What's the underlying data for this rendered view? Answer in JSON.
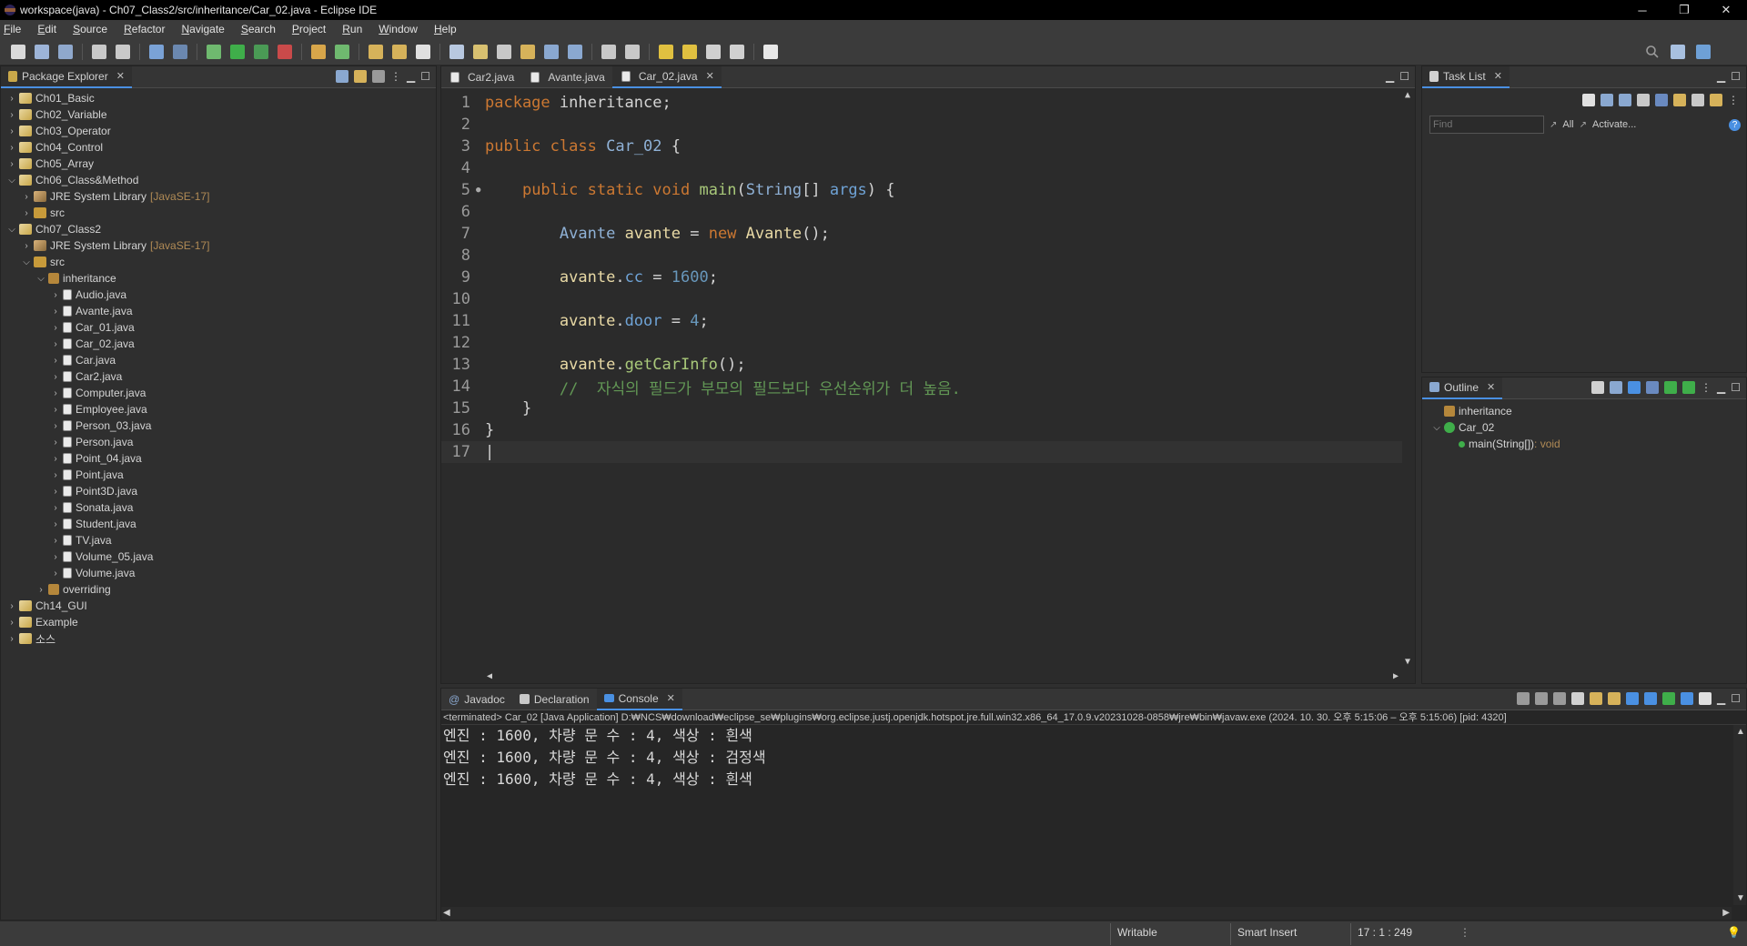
{
  "window": {
    "title": "workspace(java) - Ch07_Class2/src/inheritance/Car_02.java - Eclipse IDE",
    "minimize": "─",
    "restore": "❐",
    "close": "✕"
  },
  "menu": [
    "File",
    "Edit",
    "Source",
    "Refactor",
    "Navigate",
    "Search",
    "Project",
    "Run",
    "Window",
    "Help"
  ],
  "package_explorer": {
    "title": "Package Explorer",
    "tree": [
      {
        "depth": 0,
        "expanded": false,
        "icon": "project",
        "label": "Ch01_Basic"
      },
      {
        "depth": 0,
        "expanded": false,
        "icon": "project",
        "label": "Ch02_Variable"
      },
      {
        "depth": 0,
        "expanded": false,
        "icon": "project",
        "label": "Ch03_Operator"
      },
      {
        "depth": 0,
        "expanded": false,
        "icon": "project",
        "label": "Ch04_Control"
      },
      {
        "depth": 0,
        "expanded": false,
        "icon": "project",
        "label": "Ch05_Array"
      },
      {
        "depth": 0,
        "expanded": true,
        "icon": "project",
        "label": "Ch06_Class&Method"
      },
      {
        "depth": 1,
        "expanded": false,
        "icon": "lib",
        "label": "JRE System Library",
        "tag": "[JavaSE-17]"
      },
      {
        "depth": 1,
        "expanded": false,
        "icon": "src",
        "label": "src"
      },
      {
        "depth": 0,
        "expanded": true,
        "icon": "project",
        "label": "Ch07_Class2"
      },
      {
        "depth": 1,
        "expanded": false,
        "icon": "lib",
        "label": "JRE System Library",
        "tag": "[JavaSE-17]"
      },
      {
        "depth": 1,
        "expanded": true,
        "icon": "src",
        "label": "src"
      },
      {
        "depth": 2,
        "expanded": true,
        "icon": "pkg",
        "label": "inheritance"
      },
      {
        "depth": 3,
        "expanded": false,
        "icon": "java",
        "label": "Audio.java"
      },
      {
        "depth": 3,
        "expanded": false,
        "icon": "java",
        "label": "Avante.java"
      },
      {
        "depth": 3,
        "expanded": false,
        "icon": "java",
        "label": "Car_01.java"
      },
      {
        "depth": 3,
        "expanded": false,
        "icon": "java",
        "label": "Car_02.java"
      },
      {
        "depth": 3,
        "expanded": false,
        "icon": "java",
        "label": "Car.java"
      },
      {
        "depth": 3,
        "expanded": false,
        "icon": "java",
        "label": "Car2.java"
      },
      {
        "depth": 3,
        "expanded": false,
        "icon": "java",
        "label": "Computer.java"
      },
      {
        "depth": 3,
        "expanded": false,
        "icon": "java",
        "label": "Employee.java"
      },
      {
        "depth": 3,
        "expanded": false,
        "icon": "java",
        "label": "Person_03.java"
      },
      {
        "depth": 3,
        "expanded": false,
        "icon": "java",
        "label": "Person.java"
      },
      {
        "depth": 3,
        "expanded": false,
        "icon": "java",
        "label": "Point_04.java"
      },
      {
        "depth": 3,
        "expanded": false,
        "icon": "java",
        "label": "Point.java"
      },
      {
        "depth": 3,
        "expanded": false,
        "icon": "java",
        "label": "Point3D.java"
      },
      {
        "depth": 3,
        "expanded": false,
        "icon": "java",
        "label": "Sonata.java"
      },
      {
        "depth": 3,
        "expanded": false,
        "icon": "java",
        "label": "Student.java"
      },
      {
        "depth": 3,
        "expanded": false,
        "icon": "java",
        "label": "TV.java"
      },
      {
        "depth": 3,
        "expanded": false,
        "icon": "java",
        "label": "Volume_05.java"
      },
      {
        "depth": 3,
        "expanded": false,
        "icon": "java",
        "label": "Volume.java"
      },
      {
        "depth": 2,
        "expanded": false,
        "icon": "pkg",
        "label": "overriding"
      },
      {
        "depth": 0,
        "expanded": false,
        "icon": "project",
        "label": "Ch14_GUI"
      },
      {
        "depth": 0,
        "expanded": false,
        "icon": "project",
        "label": "Example"
      },
      {
        "depth": 0,
        "expanded": false,
        "icon": "project",
        "label": "소스"
      }
    ]
  },
  "editor": {
    "tabs": [
      {
        "label": "Car2.java",
        "active": false
      },
      {
        "label": "Avante.java",
        "active": false
      },
      {
        "label": "Car_02.java",
        "active": true
      }
    ],
    "lines": [
      {
        "n": "1",
        "tokens": [
          [
            "kw",
            "package"
          ],
          [
            "txt",
            " inheritance;"
          ]
        ]
      },
      {
        "n": "2",
        "tokens": []
      },
      {
        "n": "3",
        "tokens": [
          [
            "kw",
            "public"
          ],
          [
            "txt",
            " "
          ],
          [
            "kw",
            "class"
          ],
          [
            "txt",
            " "
          ],
          [
            "cls",
            "Car_02"
          ],
          [
            "txt",
            " {"
          ]
        ]
      },
      {
        "n": "4",
        "tokens": []
      },
      {
        "n": "5",
        "marker": "●",
        "tokens": [
          [
            "txt",
            "    "
          ],
          [
            "kw",
            "public"
          ],
          [
            "txt",
            " "
          ],
          [
            "kw",
            "static"
          ],
          [
            "txt",
            " "
          ],
          [
            "kw",
            "void"
          ],
          [
            "txt",
            " "
          ],
          [
            "mth",
            "main"
          ],
          [
            "txt",
            "("
          ],
          [
            "cls",
            "String"
          ],
          [
            "txt",
            "[] "
          ],
          [
            "fld",
            "args"
          ],
          [
            "txt",
            ") {"
          ]
        ]
      },
      {
        "n": "6",
        "tokens": []
      },
      {
        "n": "7",
        "tokens": [
          [
            "txt",
            "        "
          ],
          [
            "cls",
            "Avante"
          ],
          [
            "txt",
            " "
          ],
          [
            "var",
            "avante"
          ],
          [
            "txt",
            " = "
          ],
          [
            "kw",
            "new"
          ],
          [
            "txt",
            " "
          ],
          [
            "var",
            "Avante"
          ],
          [
            "txt",
            "();"
          ]
        ]
      },
      {
        "n": "8",
        "tokens": []
      },
      {
        "n": "9",
        "tokens": [
          [
            "txt",
            "        "
          ],
          [
            "var",
            "avante"
          ],
          [
            "txt",
            "."
          ],
          [
            "fld",
            "cc"
          ],
          [
            "txt",
            " = "
          ],
          [
            "num",
            "1600"
          ],
          [
            "txt",
            ";"
          ]
        ]
      },
      {
        "n": "10",
        "tokens": []
      },
      {
        "n": "11",
        "tokens": [
          [
            "txt",
            "        "
          ],
          [
            "var",
            "avante"
          ],
          [
            "txt",
            "."
          ],
          [
            "fld",
            "door"
          ],
          [
            "txt",
            " = "
          ],
          [
            "num",
            "4"
          ],
          [
            "txt",
            ";"
          ]
        ]
      },
      {
        "n": "12",
        "tokens": []
      },
      {
        "n": "13",
        "tokens": [
          [
            "txt",
            "        "
          ],
          [
            "var",
            "avante"
          ],
          [
            "txt",
            "."
          ],
          [
            "mth",
            "getCarInfo"
          ],
          [
            "txt",
            "();"
          ]
        ]
      },
      {
        "n": "14",
        "tokens": [
          [
            "txt",
            "        "
          ],
          [
            "cmt",
            "//  자식의 필드가 부모의 필드보다 우선순위가 더 높음."
          ]
        ]
      },
      {
        "n": "15",
        "tokens": [
          [
            "txt",
            "    }"
          ]
        ]
      },
      {
        "n": "16",
        "tokens": [
          [
            "txt",
            "}"
          ]
        ]
      },
      {
        "n": "17",
        "current": true,
        "tokens": [
          [
            "txt",
            "|"
          ]
        ]
      }
    ]
  },
  "task_list": {
    "title": "Task List",
    "find_placeholder": "Find",
    "all_label": "All",
    "activate_label": "Activate..."
  },
  "outline": {
    "title": "Outline",
    "items": [
      {
        "depth": 0,
        "label": "inheritance",
        "suffix": ""
      },
      {
        "depth": 0,
        "expanded": true,
        "label": "Car_02",
        "suffix": ""
      },
      {
        "depth": 1,
        "label": "main(String[])",
        "suffix": " : void"
      }
    ]
  },
  "bottom": {
    "tabs": [
      {
        "label": "Javadoc",
        "active": false
      },
      {
        "label": "Declaration",
        "active": false
      },
      {
        "label": "Console",
        "active": true
      }
    ],
    "terminated": "<terminated> Car_02 [Java Application] D:₩NCS₩download₩eclipse_se₩plugins₩org.eclipse.justj.openjdk.hotspot.jre.full.win32.x86_64_17.0.9.v20231028-0858₩jre₩bin₩javaw.exe  (2024. 10. 30. 오후 5:15:06 – 오후 5:15:06) [pid: 4320]",
    "output": [
      "엔진 : 1600, 차량 문 수 : 4, 색상 : 흰색",
      "엔진 : 1600, 차량 문 수 : 4, 색상 : 검정색",
      "엔진 : 1600, 차량 문 수 : 4, 색상 : 흰색"
    ]
  },
  "status": {
    "writable": "Writable",
    "insert_mode": "Smart Insert",
    "position": "17 : 1 : 249"
  },
  "colors": {
    "accent": "#4a90e2",
    "keyword": "#cc7832",
    "comment": "#629755"
  }
}
